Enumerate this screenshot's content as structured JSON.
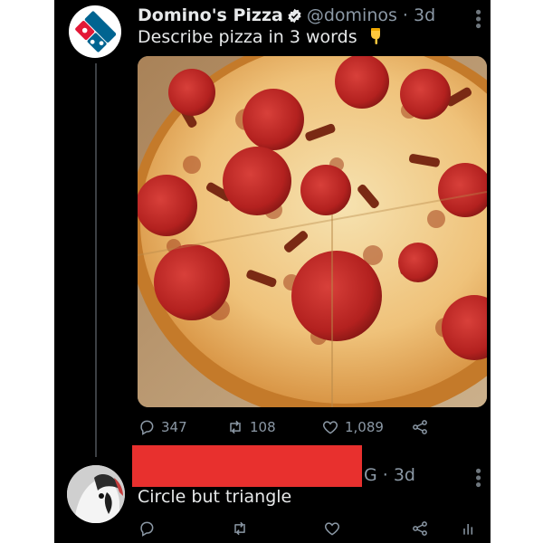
{
  "tweet": {
    "author_name": "Domino's Pizza",
    "handle_time": "@dominos · 3d",
    "text": "Describe pizza in 3 words",
    "replies": "347",
    "retweets": "108",
    "likes": "1,089"
  },
  "reply": {
    "handle_time_visible": "G · 3d",
    "text": "Circle but triangle"
  },
  "colors": {
    "background": "#000000",
    "text_primary": "#e7e9ea",
    "text_secondary": "#8b98a5",
    "verified_blue": "#1d9bf0",
    "dominos_blue": "#006491",
    "dominos_red": "#e31837",
    "redaction": "#e8302e"
  },
  "icons": [
    "dominos-logo-icon",
    "verified-badge-icon",
    "more-icon",
    "pointing-down-emoji-icon",
    "reply-icon",
    "retweet-icon",
    "like-icon",
    "share-icon",
    "analytics-icon"
  ]
}
